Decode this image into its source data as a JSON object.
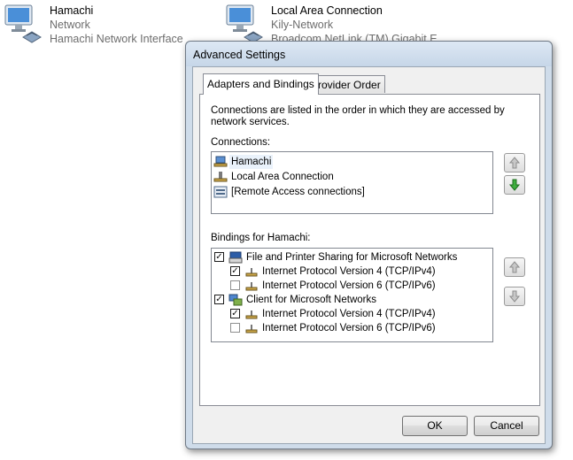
{
  "adapters": [
    {
      "name": "Hamachi",
      "status": "Network",
      "device": "Hamachi Network Interface"
    },
    {
      "name": "Local Area Connection",
      "status": "Kily-Network",
      "device": "Broadcom NetLink (TM) Gigabit E..."
    }
  ],
  "dialog": {
    "title": "Advanced Settings",
    "tabs": [
      "Adapters and Bindings",
      "Provider Order"
    ],
    "description_line1": "Connections are listed in the order in which they are accessed by",
    "description_line2": "network services.",
    "connections_label": "Connections:",
    "connections": [
      {
        "label": "Hamachi",
        "icon": "network-adapter-icon",
        "selected": true
      },
      {
        "label": "Local Area Connection",
        "icon": "network-adapter-icon",
        "selected": false
      },
      {
        "label": "[Remote Access connections]",
        "icon": "remote-access-icon",
        "selected": false
      }
    ],
    "bindings_label": "Bindings for Hamachi:",
    "bindings": [
      {
        "label": "File and Printer Sharing for Microsoft Networks",
        "checked": true,
        "level": 0,
        "icon": "printer-sharing-icon"
      },
      {
        "label": "Internet Protocol Version 4 (TCP/IPv4)",
        "checked": true,
        "level": 1,
        "icon": "protocol-icon"
      },
      {
        "label": "Internet Protocol Version 6 (TCP/IPv6)",
        "checked": false,
        "level": 1,
        "icon": "protocol-icon"
      },
      {
        "label": "Client for Microsoft Networks",
        "checked": true,
        "level": 0,
        "icon": "network-client-icon"
      },
      {
        "label": "Internet Protocol Version 4 (TCP/IPv4)",
        "checked": true,
        "level": 1,
        "icon": "protocol-icon"
      },
      {
        "label": "Internet Protocol Version 6 (TCP/IPv6)",
        "checked": false,
        "level": 1,
        "icon": "protocol-icon"
      }
    ],
    "ok_label": "OK",
    "cancel_label": "Cancel"
  },
  "colors": {
    "dialog_frame": "#cfdcea",
    "move_down_enabled": "#2f9b2f",
    "arrow_disabled": "#9a9a9a"
  }
}
